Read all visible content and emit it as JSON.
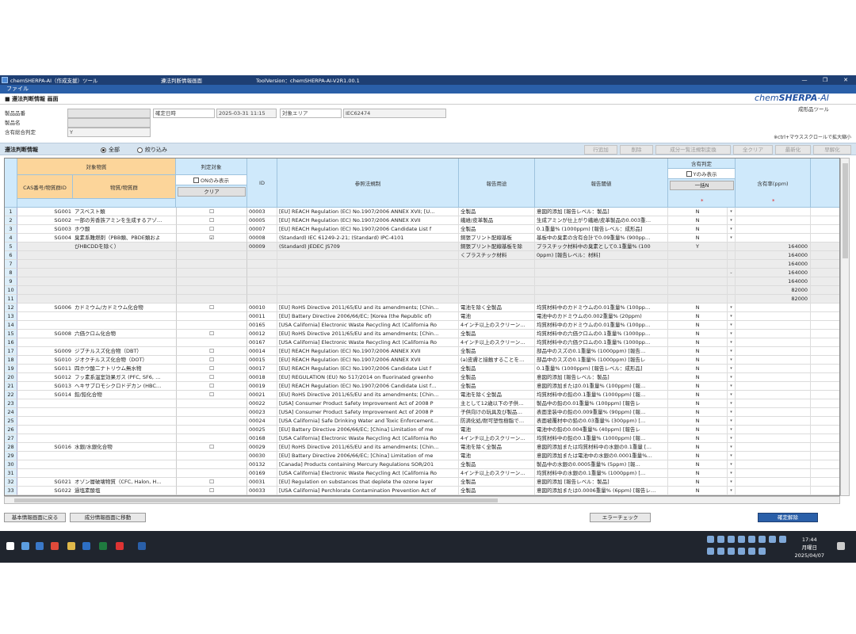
{
  "window": {
    "app_title": "chemSHERPA-AI（作成支援）ツール",
    "screen_title": "遵法判断情報画面",
    "version": "ToolVersion：chemSHERPA-AI-V2R1.00.1",
    "controls": [
      "—",
      "❐",
      "✕"
    ]
  },
  "menu": {
    "file": "ファイル"
  },
  "screen": {
    "name": "■ 遵法判断情報 画面",
    "logo_prefix": "chem",
    "logo_main": "SHERPA",
    "logo_suffix": "-AI",
    "logo_sub": "成形品ツール"
  },
  "info": {
    "part_number_label": "製品品番",
    "part_name_label": "製品名",
    "overall_label": "含有総合判定",
    "overall_value": "Y",
    "date_label": "確定日時",
    "date_value": "2025-03-31 11:15",
    "area_label": "対象エリア",
    "area_value": "IEC62474",
    "hint": "※ctrl+マウススクロールで拡大縮小"
  },
  "filter": {
    "label": "遵法判断情報",
    "all": "全部",
    "narrow": "絞り込み",
    "buttons": [
      "行追加",
      "削除",
      "成分一覧法規制変換",
      "全クリア",
      "最新化",
      "早解化"
    ]
  },
  "header": {
    "target_substance": "対象物質",
    "cas": "CAS番号/物質群ID",
    "substance_name": "物質/物質群",
    "judge_target": "判定対象",
    "on_only": "ONのみ表示",
    "clear": "クリア",
    "id": "ID",
    "regulation": "参照法規制",
    "use": "報告用途",
    "threshold": "報告閾値",
    "contain_judge": "含有判定",
    "y_only": "Yのみ表示",
    "bulk_n": "一括N",
    "ppm": "含有率(ppm)",
    "required_mark": "*"
  },
  "rows": [
    {
      "no": "1",
      "cas": "SG001",
      "name": "アスベスト類",
      "chk": "☐",
      "id": "00003",
      "reg": "[EU] REACH Regulation (EC) No.1907/2006 ANNEX XVII; [U…",
      "use": "全製品",
      "thr": "意図的添加 [報告レベル：製品]",
      "cont": "N",
      "dd": "▾",
      "ppm": ""
    },
    {
      "no": "2",
      "cas": "SG002",
      "name": "一部の芳香族アミンを生成するアゾ…",
      "chk": "☐",
      "id": "00005",
      "reg": "[EU] REACH Regulation (EC) No.1907/2006 ANNEX XVII",
      "use": "繊維/皮革製品",
      "thr": "生成アミンが仕上がり繊維/皮革製品の0.003重…",
      "cont": "N",
      "dd": "▾",
      "ppm": ""
    },
    {
      "no": "3",
      "cas": "SG003",
      "name": "ホウ酸",
      "chk": "☐",
      "id": "00007",
      "reg": "[EU] REACH Regulation (EC) No.1907/2006 Candidate List f",
      "use": "全製品",
      "thr": "0.1重量% (1000ppm) [報告レベル：成形品]",
      "cont": "N",
      "dd": "▾",
      "ppm": ""
    },
    {
      "no": "4",
      "cas": "SG004",
      "name": "臭素系難燃剤（PBB類、PBDE類およ",
      "chk": "☑",
      "id": "00008",
      "reg": "(Standard) IEC 61249-2-21; (Standard) IPC-4101",
      "use": "銅張プリント配線基板",
      "thr": "基板中の臭素の含有合計で0.09重量% (900pp…",
      "cont": "N",
      "dd": "▾",
      "ppm": ""
    },
    {
      "no": "5",
      "cas": "",
      "name": "びHBCDDを除く）",
      "chk": "",
      "id": "00009",
      "reg": "(Standard) JEDEC JS709",
      "use": "銅張プリント配線基板を除",
      "thr": "プラスチック材料中の臭素として0.1重量% (100",
      "cont": "Y",
      "dd": "",
      "ppm": "164000"
    },
    {
      "no": "6",
      "cas": "",
      "name": "",
      "chk": "",
      "id": "",
      "reg": "",
      "use": "くプラスチック材料",
      "thr": "0ppm) [報告レベル：材料]",
      "cont": "",
      "dd": "",
      "ppm": "164000"
    },
    {
      "no": "7",
      "cas": "",
      "name": "",
      "chk": "",
      "id": "",
      "reg": "",
      "use": "",
      "thr": "",
      "cont": "",
      "dd": "",
      "ppm": "164000"
    },
    {
      "no": "8",
      "cas": "",
      "name": "",
      "chk": "",
      "id": "",
      "reg": "",
      "use": "",
      "thr": "",
      "cont": "",
      "dd": "⌄",
      "ppm": "164000"
    },
    {
      "no": "9",
      "cas": "",
      "name": "",
      "chk": "",
      "id": "",
      "reg": "",
      "use": "",
      "thr": "",
      "cont": "",
      "dd": "",
      "ppm": "164000"
    },
    {
      "no": "10",
      "cas": "",
      "name": "",
      "chk": "",
      "id": "",
      "reg": "",
      "use": "",
      "thr": "",
      "cont": "",
      "dd": "",
      "ppm": "82000"
    },
    {
      "no": "11",
      "cas": "",
      "name": "",
      "chk": "",
      "id": "",
      "reg": "",
      "use": "",
      "thr": "",
      "cont": "",
      "dd": "",
      "ppm": "82000"
    },
    {
      "no": "12",
      "cas": "SG006",
      "name": "カドミウム/カドミウム化合物",
      "chk": "☐",
      "id": "00010",
      "reg": "[EU] RoHS Directive 2011/65/EU and its amendments; [Chin…",
      "use": "電池を除く全製品",
      "thr": "均質材料中のカドミウムの0.01重量% (100pp…",
      "cont": "N",
      "dd": "▾",
      "ppm": ""
    },
    {
      "no": "13",
      "cas": "",
      "name": "",
      "chk": "",
      "id": "00011",
      "reg": "[EU] Battery Directive 2006/66/EC; [Korea (the Republic of)",
      "use": "電池",
      "thr": "電池中のカドミウムの0.002重量% (20ppm)",
      "cont": "N",
      "dd": "▾",
      "ppm": ""
    },
    {
      "no": "14",
      "cas": "",
      "name": "",
      "chk": "",
      "id": "00165",
      "reg": "[USA California] Electronic Waste Recycling Act (California Ro",
      "use": "4インチ以上のスクリーン…",
      "thr": "均質材料中のカドミウムの0.01重量% (100pp…",
      "cont": "N",
      "dd": "▾",
      "ppm": ""
    },
    {
      "no": "15",
      "cas": "SG008",
      "name": "六価クロム化合物",
      "chk": "☐",
      "id": "00012",
      "reg": "[EU] RoHS Directive 2011/65/EU and its amendments; [Chin…",
      "use": "全製品",
      "thr": "均質材料中の六価クロムの0.1重量% (1000pp…",
      "cont": "N",
      "dd": "▾",
      "ppm": ""
    },
    {
      "no": "16",
      "cas": "",
      "name": "",
      "chk": "",
      "id": "00167",
      "reg": "[USA California] Electronic Waste Recycling Act (California Ro",
      "use": "4インチ以上のスクリーン…",
      "thr": "均質材料中の六価クロムの0.1重量% (1000pp…",
      "cont": "N",
      "dd": "▾",
      "ppm": ""
    },
    {
      "no": "17",
      "cas": "SG009",
      "name": "ジブチルスズ化合物（DBT）",
      "chk": "☐",
      "id": "00014",
      "reg": "[EU] REACH Regulation (EC) No.1907/2006 ANNEX XVII",
      "use": "全製品",
      "thr": "部品中のスズの0.1重量% (1000ppm) [報告…",
      "cont": "N",
      "dd": "▾",
      "ppm": ""
    },
    {
      "no": "18",
      "cas": "SG010",
      "name": "ジオクチルスズ化合物（DOT）",
      "chk": "☐",
      "id": "00015",
      "reg": "[EU] REACH Regulation (EC) No.1907/2006 ANNEX XVII",
      "use": "(a)皮膚と接触することを…",
      "thr": "部品中のスズの0.1重量% (1000ppm) [報告レ",
      "cont": "N",
      "dd": "▾",
      "ppm": ""
    },
    {
      "no": "19",
      "cas": "SG011",
      "name": "四ホウ酸二ナトリウム無水物",
      "chk": "☐",
      "id": "00017",
      "reg": "[EU] REACH Regulation (EC) No.1907/2006 Candidate List f",
      "use": "全製品",
      "thr": "0.1重量% (1000ppm) [報告レベル：成形品]",
      "cont": "N",
      "dd": "▾",
      "ppm": ""
    },
    {
      "no": "20",
      "cas": "SG012",
      "name": "フッ素系温室効果ガス (PFC, SF6, …",
      "chk": "☐",
      "id": "00018",
      "reg": "[EU] REGULATION (EU) No 517/2014 on fluorinated greenho",
      "use": "全製品",
      "thr": "意図的添加 [報告レベル：製品]",
      "cont": "N",
      "dd": "▾",
      "ppm": ""
    },
    {
      "no": "21",
      "cas": "SG013",
      "name": "ヘキサブロモシクロドデカン (HBC…",
      "chk": "☐",
      "id": "00019",
      "reg": "[EU] REACH Regulation (EC) No.1907/2006 Candidate List f…",
      "use": "全製品",
      "thr": "意図的添加または0.01重量% (100ppm) [報…",
      "cont": "N",
      "dd": "▾",
      "ppm": ""
    },
    {
      "no": "22",
      "cas": "SG014",
      "name": "鉛/鉛化合物",
      "chk": "☐",
      "id": "00021",
      "reg": "[EU] RoHS Directive 2011/65/EU and its amendments; [Chin…",
      "use": "電池を除く全製品",
      "thr": "均質材料中の鉛の0.1重量% (1000ppm) [報…",
      "cont": "N",
      "dd": "▾",
      "ppm": ""
    },
    {
      "no": "23",
      "cas": "",
      "name": "",
      "chk": "",
      "id": "00022",
      "reg": "[USA] Consumer Product Safety Improvement Act of 2008 P",
      "use": "主として12歳以下の子供…",
      "thr": "製品中の鉛の0.01重量% (100ppm) [報告レ",
      "cont": "N",
      "dd": "▾",
      "ppm": ""
    },
    {
      "no": "24",
      "cas": "",
      "name": "",
      "chk": "",
      "id": "00023",
      "reg": "[USA] Consumer Product Safety Improvement Act of 2008 P",
      "use": "子供向けの玩具及び製品…",
      "thr": "表面塗装中の鉛の0.009重量% (90ppm) [報…",
      "cont": "N",
      "dd": "▾",
      "ppm": ""
    },
    {
      "no": "25",
      "cas": "",
      "name": "",
      "chk": "",
      "id": "00024",
      "reg": "[USA California] Safe Drinking Water and Toxic Enforcement…",
      "use": "防滴化処/耐可塑性樹脂で…",
      "thr": "表面被覆材中の鉛の0.03重量% (300ppm) […",
      "cont": "N",
      "dd": "▾",
      "ppm": ""
    },
    {
      "no": "26",
      "cas": "",
      "name": "",
      "chk": "",
      "id": "00025",
      "reg": "[EU] Battery Directive 2006/66/EC; [China] Limitation of me",
      "use": "電池",
      "thr": "電池中の鉛の0.004重量% (40ppm) [報告レ",
      "cont": "N",
      "dd": "▾",
      "ppm": ""
    },
    {
      "no": "27",
      "cas": "",
      "name": "",
      "chk": "",
      "id": "00168",
      "reg": "[USA California] Electronic Waste Recycling Act (California Ro",
      "use": "4インチ以上のスクリーン…",
      "thr": "均質材料中の鉛の0.1重量% (1000ppm) [報…",
      "cont": "N",
      "dd": "▾",
      "ppm": ""
    },
    {
      "no": "28",
      "cas": "SG016",
      "name": "水銀/水銀化合物",
      "chk": "☐",
      "id": "00029",
      "reg": "[EU] RoHS Directive 2011/65/EU and its amendments; [Chin…",
      "use": "電池を除く全製品",
      "thr": "意図的添加または均質材料中の水銀の0.1重量 […",
      "cont": "N",
      "dd": "▾",
      "ppm": ""
    },
    {
      "no": "29",
      "cas": "",
      "name": "",
      "chk": "",
      "id": "00030",
      "reg": "[EU] Battery Directive 2006/66/EC; [China] Limitation of me",
      "use": "電池",
      "thr": "意図的添加または電池中の水銀の0.0001重量%…",
      "cont": "N",
      "dd": "▾",
      "ppm": ""
    },
    {
      "no": "30",
      "cas": "",
      "name": "",
      "chk": "",
      "id": "00132",
      "reg": "[Canada] Products containing Mercury Regulations SOR/201",
      "use": "全製品",
      "thr": "製品中の水銀の0.0005重量% (5ppm) [報…",
      "cont": "N",
      "dd": "▾",
      "ppm": ""
    },
    {
      "no": "31",
      "cas": "",
      "name": "",
      "chk": "",
      "id": "00169",
      "reg": "[USA California] Electronic Waste Recycling Act (California Ro",
      "use": "4インチ以上のスクリーン…",
      "thr": "均質材料中の水銀の0.1重量% (1000ppm) […",
      "cont": "N",
      "dd": "▾",
      "ppm": ""
    },
    {
      "no": "32",
      "cas": "SG021",
      "name": "オゾン層破壊物質（CFC, Halon, H…",
      "chk": "☐",
      "id": "00031",
      "reg": "[EU] Regulation on substances that deplete the ozone layer",
      "use": "全製品",
      "thr": "意図的添加 [報告レベル：製品]",
      "cont": "N",
      "dd": "▾",
      "ppm": ""
    },
    {
      "no": "33",
      "cas": "SG022",
      "name": "過塩素酸塩",
      "chk": "☐",
      "id": "00033",
      "reg": "[USA California] Perchlorate Contamination Prevention Act of",
      "use": "全製品",
      "thr": "意図的添加または0.0006重量% (6ppm) [報告レ…",
      "cont": "N",
      "dd": "▾",
      "ppm": ""
    }
  ],
  "bottom": {
    "back_basic": "基本情報画面に戻る",
    "to_component": "成分情報画面に移動",
    "error_check": "エラーチェック",
    "confirm_release": "確定解除"
  },
  "taskbar": {
    "time": "17:44",
    "day": "月曜日",
    "date": "2025/04/07"
  },
  "colors": {
    "title_blue": "#1e3f73",
    "header_light_blue": "#cfe9fb",
    "header_orange": "#fcd59a"
  }
}
